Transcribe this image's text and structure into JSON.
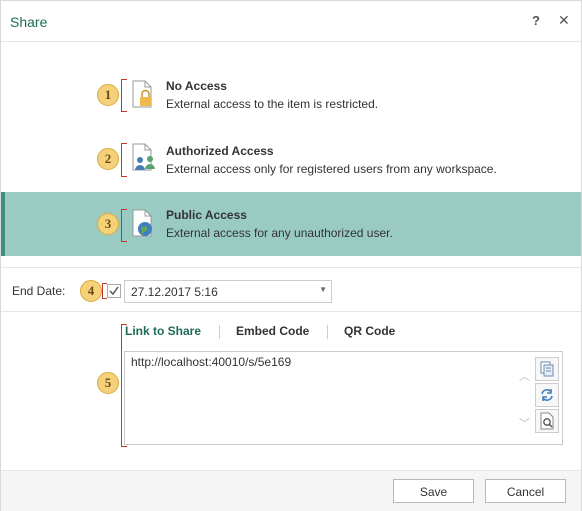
{
  "dialog": {
    "title": "Share",
    "help_label": "?",
    "close_label": "✕"
  },
  "options": [
    {
      "number": "1",
      "title": "No Access",
      "description": "External access to the item is restricted.",
      "icon": "lock-document-icon"
    },
    {
      "number": "2",
      "title": "Authorized Access",
      "description": "External access only for registered users from any workspace.",
      "icon": "users-document-icon"
    },
    {
      "number": "3",
      "title": "Public Access",
      "description": "External access for any unauthorized user.",
      "icon": "globe-document-icon",
      "selected": true
    }
  ],
  "end_date": {
    "label": "End Date:",
    "badge": "4",
    "checked": true,
    "value": "27.12.2017 5:16"
  },
  "share_tabs": {
    "badge": "5",
    "items": [
      "Link to Share",
      "Embed Code",
      "QR Code"
    ],
    "active": "Link to Share"
  },
  "link": {
    "url": "http://localhost:40010/s/5e169"
  },
  "footer": {
    "save_label": "Save",
    "cancel_label": "Cancel"
  },
  "colors": {
    "accent": "#1f6b57",
    "selected_bg": "#99cbc3",
    "badge": "#f5d27a",
    "bracket": "#c0392b"
  }
}
